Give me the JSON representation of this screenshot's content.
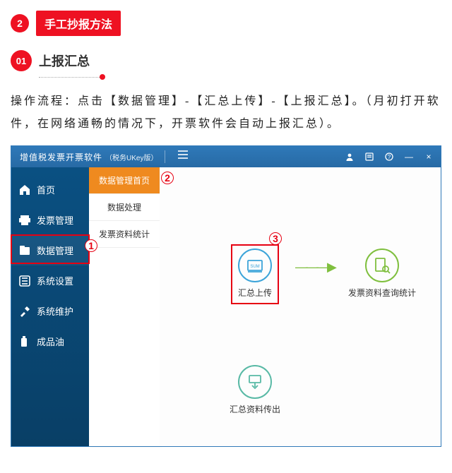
{
  "article": {
    "badge_number": "2",
    "badge_text": "手工抄报方法",
    "step_number": "01",
    "step_title": "上报汇总",
    "instructions": "操作流程：点击【数据管理】-【汇总上传】-【上报汇总】。（月初打开软件，在网络通畅的情况下，开票软件会自动上报汇总）。"
  },
  "app": {
    "title": "增值税发票开票软件",
    "edition": "（税务UKey版）",
    "titlebar_buttons": {
      "minimize": "—",
      "close": "×"
    }
  },
  "sidebar": {
    "items": [
      {
        "label": "首页"
      },
      {
        "label": "发票管理"
      },
      {
        "label": "数据管理",
        "selected": true
      },
      {
        "label": "系统设置"
      },
      {
        "label": "系统维护"
      },
      {
        "label": "成品油"
      }
    ]
  },
  "submenu": {
    "items": [
      {
        "label": "数据管理首页",
        "active": true
      },
      {
        "label": "数据处理"
      },
      {
        "label": "发票资料统计"
      }
    ]
  },
  "canvas": {
    "tiles": [
      {
        "label": "汇总上传"
      },
      {
        "label": "发票资料查询统计"
      },
      {
        "label": "汇总资料传出"
      }
    ]
  },
  "callouts": {
    "one": "1",
    "two": "2",
    "three": "3"
  }
}
